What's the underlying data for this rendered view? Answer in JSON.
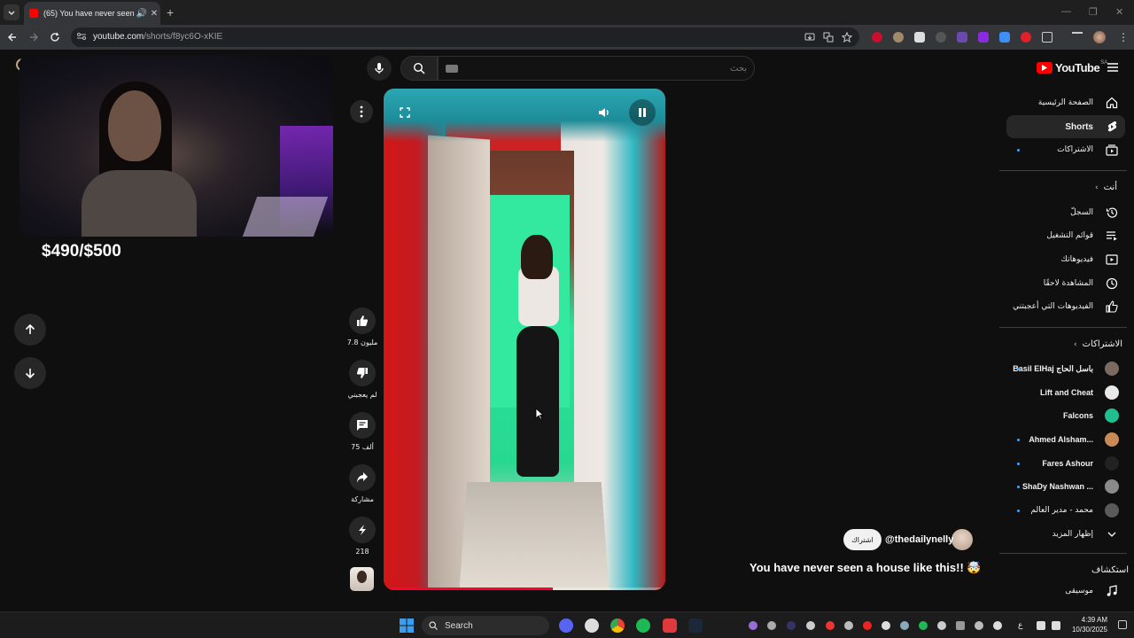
{
  "browser": {
    "tab_title": "(65) You have never seen a",
    "url_host": "youtube.com",
    "url_path": "/shorts/f8yc6O-xKIE",
    "new_tab": "+",
    "minimize": "—",
    "maximize": "❐",
    "close": "✕"
  },
  "stream_overlay": {
    "goal": "$490/$500"
  },
  "header": {
    "search_placeholder": "بحث",
    "logo_text": "YouTube",
    "country_code": "SA"
  },
  "short": {
    "likes": "7.8 مليون",
    "dislike_label": "لم يعجبني",
    "comments": "75 ألف",
    "share_label": "مشاركة",
    "remix_count": "218",
    "channel_handle": "@thedailynelly",
    "subscribe_label": "اشتراك",
    "title": "You have never seen a house like this!! 🤯",
    "progress": 0.6
  },
  "sidebar": {
    "main": [
      {
        "label": "الصفحة الرئيسية",
        "icon": "home-icon",
        "active": false
      },
      {
        "label": "Shorts",
        "icon": "shorts-icon",
        "active": true
      },
      {
        "label": "الاشتراكات",
        "icon": "subscriptions-icon",
        "active": false,
        "dot": true
      }
    ],
    "you_header": "أنت",
    "you": [
      {
        "label": "السجلّ",
        "icon": "history-icon"
      },
      {
        "label": "قوائم التشغيل",
        "icon": "playlists-icon"
      },
      {
        "label": "فيديوهاتك",
        "icon": "your-videos-icon"
      },
      {
        "label": "المشاهدة لاحقًا",
        "icon": "watch-later-icon"
      },
      {
        "label": "الفيديوهات التي أعجبتني",
        "icon": "liked-videos-icon"
      }
    ],
    "subs_header": "الاشتراكات",
    "subscriptions": [
      {
        "label": "Basil ElHaj باسل الحاج",
        "dot": true,
        "color": "#7a6a60"
      },
      {
        "label": "Lift and Cheat",
        "dot": false,
        "color": "#e8e8e8"
      },
      {
        "label": "Falcons",
        "dot": false,
        "color": "#1fbf8f"
      },
      {
        "label": "Ahmed Alsham...",
        "dot": true,
        "color": "#c98a55"
      },
      {
        "label": "Fares Ashour",
        "dot": true,
        "color": "#222222"
      },
      {
        "label": "ShaDy Nashwan ...",
        "dot": true,
        "color": "#8a8a8a"
      },
      {
        "label": "محمد - مدير العالم",
        "dot": true,
        "color": "#5a5a5a"
      }
    ],
    "show_more": "إظهار المزيد",
    "explore_header": "استكشاف",
    "explore": [
      {
        "label": "موسيقى",
        "icon": "music-icon"
      }
    ]
  },
  "taskbar": {
    "search_label": "Search",
    "time": "4:39 AM",
    "date": "10/30/2025",
    "lang": "ع"
  }
}
